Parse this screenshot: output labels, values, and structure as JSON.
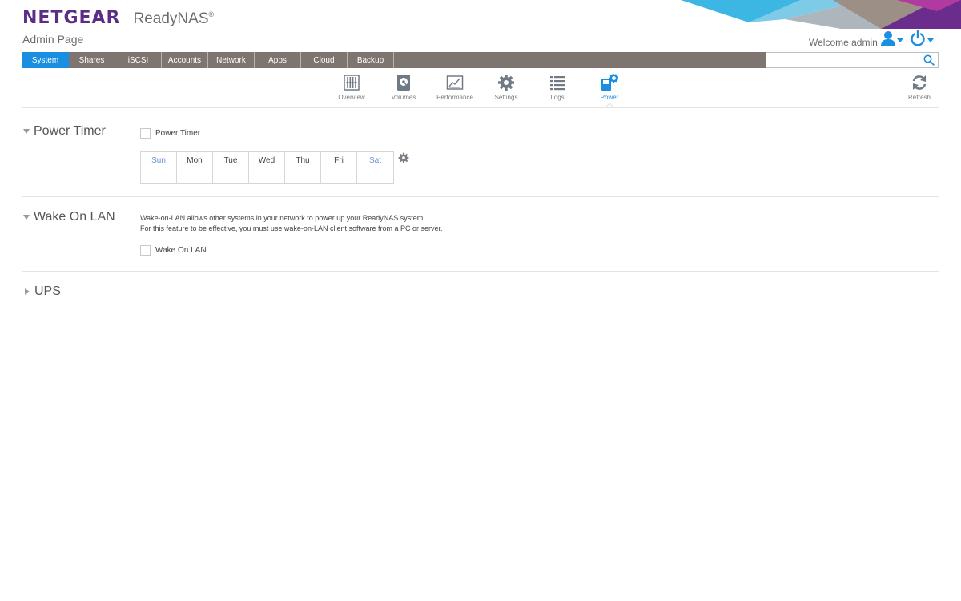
{
  "brand": {
    "logo": "NETGEAR",
    "product": "ReadyNAS",
    "product_mark": "®",
    "subtitle": "Admin Page"
  },
  "header": {
    "welcome": "Welcome admin",
    "user_icon": "user-icon",
    "power_icon": "power-icon"
  },
  "nav": {
    "tabs": [
      {
        "label": "System",
        "active": true
      },
      {
        "label": "Shares"
      },
      {
        "label": "iSCSI"
      },
      {
        "label": "Accounts"
      },
      {
        "label": "Network"
      },
      {
        "label": "Apps"
      },
      {
        "label": "Cloud"
      },
      {
        "label": "Backup"
      }
    ],
    "search": {
      "value": "",
      "placeholder": ""
    }
  },
  "subnav": {
    "items": [
      {
        "label": "Overview",
        "icon": "overview-icon"
      },
      {
        "label": "Volumes",
        "icon": "volumes-icon"
      },
      {
        "label": "Performance",
        "icon": "performance-icon"
      },
      {
        "label": "Settings",
        "icon": "settings-icon"
      },
      {
        "label": "Logs",
        "icon": "logs-icon"
      },
      {
        "label": "Power",
        "icon": "power-settings-icon",
        "active": true
      }
    ],
    "refresh": {
      "label": "Refresh",
      "icon": "refresh-icon"
    }
  },
  "power_timer": {
    "title": "Power Timer",
    "checkbox_label": "Power Timer",
    "checked": false,
    "days": [
      "Sun",
      "Mon",
      "Tue",
      "Wed",
      "Thu",
      "Fri",
      "Sat"
    ]
  },
  "wake_on_lan": {
    "title": "Wake On LAN",
    "description_line1": "Wake-on-LAN allows other systems in your network to power up your ReadyNAS system.",
    "description_line2": "For this feature to be effective, you must use wake-on-LAN client software from a PC or server.",
    "checkbox_label": "Wake On LAN",
    "checked": false
  },
  "ups": {
    "title": "UPS"
  },
  "colors": {
    "accent": "#1a8ee0",
    "brand": "#5b2d86",
    "navbar": "#7f7570",
    "weekend": "#6d93d6"
  }
}
